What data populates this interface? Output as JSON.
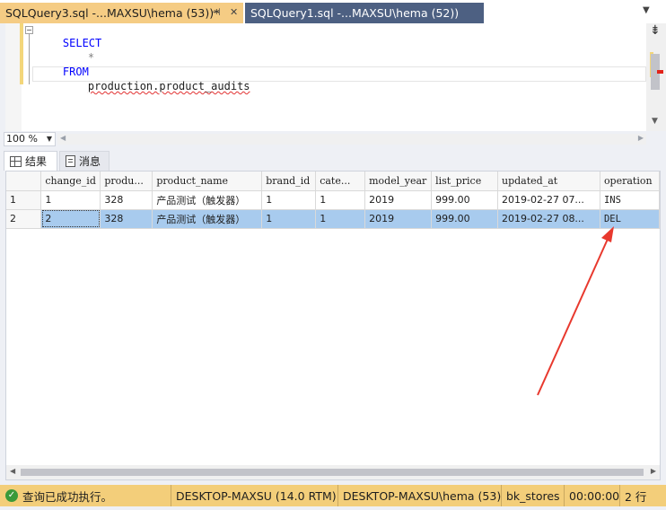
{
  "tabs": [
    {
      "label": "SQLQuery3.sql -...MAXSU\\hema (53))*",
      "active": true
    },
    {
      "label": "SQLQuery1.sql -...MAXSU\\hema (52))",
      "active": false
    }
  ],
  "tab_glyphs": {
    "pin": "⊣",
    "close": "✕",
    "dropdown": "▼"
  },
  "editor": {
    "lines": [
      {
        "keyword": "SELECT"
      },
      {
        "operator": "*"
      },
      {
        "keyword": "FROM"
      },
      {
        "identifier": "production.product_audits"
      }
    ],
    "fold_glyph": "−"
  },
  "zoom": {
    "value": "100 %"
  },
  "results_tabs": [
    {
      "label": "结果",
      "icon": "grid-icon",
      "active": true
    },
    {
      "label": "消息",
      "icon": "messages-icon",
      "active": false
    }
  ],
  "grid": {
    "columns": [
      "change_id",
      "produ...",
      "product_name",
      "brand_id",
      "cate...",
      "model_year",
      "list_price",
      "updated_at",
      "operation"
    ],
    "rows": [
      {
        "num": "1",
        "cells": [
          "1",
          "328",
          "产品测试（触发器）",
          "1",
          "1",
          "2019",
          "999.00",
          "2019-02-27 07...",
          "INS"
        ],
        "selected": false
      },
      {
        "num": "2",
        "cells": [
          "2",
          "328",
          "产品测试（触发器）",
          "1",
          "1",
          "2019",
          "999.00",
          "2019-02-27 08...",
          "DEL"
        ],
        "selected": true
      }
    ]
  },
  "status": {
    "message": "查询已成功执行。",
    "server": "DESKTOP-MAXSU (14.0 RTM)",
    "user": "DESKTOP-MAXSU\\hema (53)",
    "database": "bk_stores",
    "elapsed": "00:00:00",
    "rows": "2 行"
  },
  "colors": {
    "accent": "#f3ce7a",
    "inactive_tab": "#4d6082",
    "selection": "#a8cbee",
    "arrow": "#e8392e"
  }
}
